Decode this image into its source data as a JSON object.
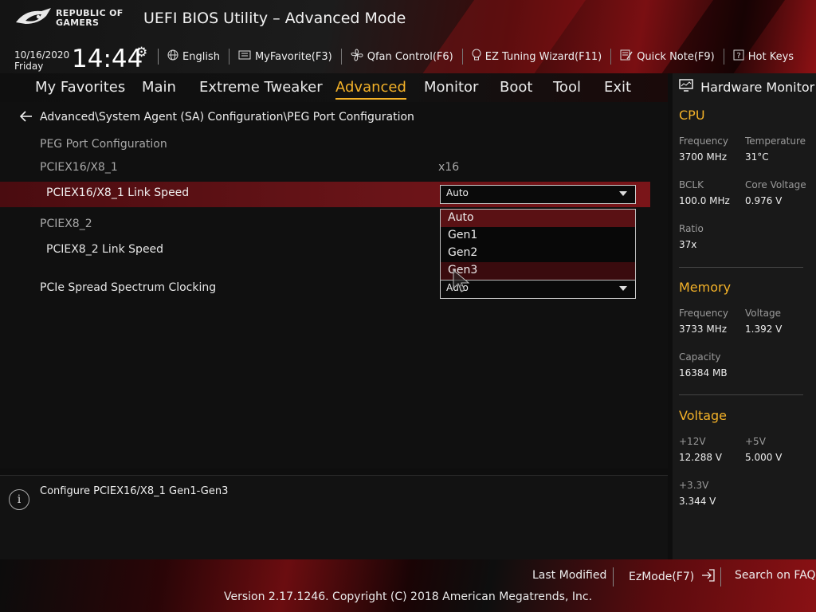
{
  "header": {
    "brand_line1": "REPUBLIC OF",
    "brand_line2": "GAMERS",
    "title": "UEFI BIOS Utility – Advanced Mode",
    "date": "10/16/2020",
    "day": "Friday",
    "time": "14:44",
    "toolbar": [
      {
        "label": "English",
        "icon": "globe-icon"
      },
      {
        "label": "MyFavorite(F3)",
        "icon": "favorite-icon"
      },
      {
        "label": "Qfan Control(F6)",
        "icon": "fan-icon"
      },
      {
        "label": "EZ Tuning Wizard(F11)",
        "icon": "bulb-icon"
      },
      {
        "label": "Quick Note(F9)",
        "icon": "note-icon"
      },
      {
        "label": "Hot Keys",
        "icon": "question-icon"
      }
    ]
  },
  "nav": {
    "tabs": [
      "My Favorites",
      "Main",
      "Extreme Tweaker",
      "Advanced",
      "Monitor",
      "Boot",
      "Tool",
      "Exit"
    ],
    "active": "Advanced"
  },
  "breadcrumb": "Advanced\\System Agent (SA) Configuration\\PEG Port Configuration",
  "settings": {
    "section_header": "PEG Port Configuration",
    "pciex16_label": "PCIEX16/X8_1",
    "pciex16_value": "x16",
    "pciex16_speed_label": "PCIEX16/X8_1 Link Speed",
    "pciex16_speed_value": "Auto",
    "pciex8_label": "PCIEX8_2",
    "pciex8_speed_label": "PCIEX8_2 Link Speed",
    "spread_label": "PCIe Spread Spectrum Clocking",
    "spread_value": "Auto"
  },
  "dropdown": {
    "options": [
      "Auto",
      "Gen1",
      "Gen2",
      "Gen3"
    ],
    "selected": "Auto",
    "hovered": "Gen3"
  },
  "help_text": "Configure PCIEX16/X8_1 Gen1-Gen3",
  "hardware_monitor": {
    "title": "Hardware Monitor",
    "cpu": {
      "title": "CPU",
      "frequency_label": "Frequency",
      "frequency": "3700 MHz",
      "temperature_label": "Temperature",
      "temperature": "31°C",
      "bclk_label": "BCLK",
      "bclk": "100.0 MHz",
      "core_voltage_label": "Core Voltage",
      "core_voltage": "0.976 V",
      "ratio_label": "Ratio",
      "ratio": "37x"
    },
    "memory": {
      "title": "Memory",
      "frequency_label": "Frequency",
      "frequency": "3733 MHz",
      "voltage_label": "Voltage",
      "voltage": "1.392 V",
      "capacity_label": "Capacity",
      "capacity": "16384 MB"
    },
    "voltage": {
      "title": "Voltage",
      "v12_label": "+12V",
      "v12": "12.288 V",
      "v5_label": "+5V",
      "v5": "5.000 V",
      "v33_label": "+3.3V",
      "v33": "3.344 V"
    }
  },
  "footer": {
    "last_modified": "Last Modified",
    "ezmode": "EzMode(F7)",
    "search_faq": "Search on FAQ",
    "copyright": "Version 2.17.1246. Copyright (C) 2018 American Megatrends, Inc."
  },
  "colors": {
    "accent": "#f4b228",
    "highlight_row": "#6a1418",
    "brand_red": "#8e1114"
  }
}
